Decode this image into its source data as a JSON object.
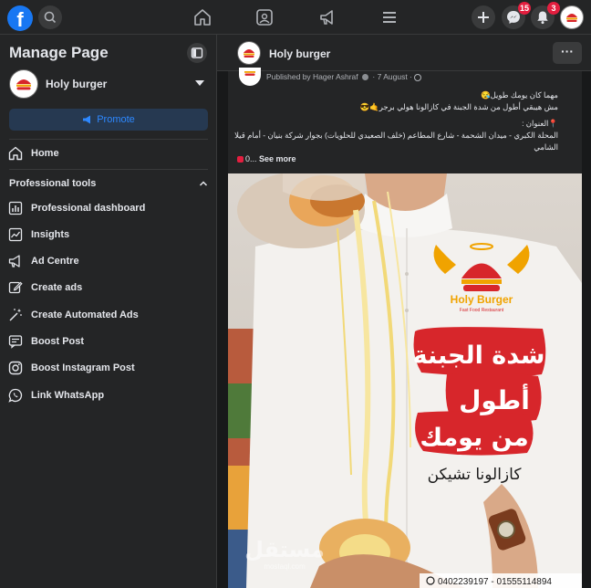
{
  "topbar": {
    "logo": "facebook-logo",
    "logo_text": "f",
    "nav": [
      "home-icon",
      "video-icon",
      "megaphone-icon",
      "menu-icon"
    ],
    "messenger_badge": "15",
    "notifications_badge": "3"
  },
  "sidebar": {
    "title": "Manage Page",
    "page_name": "Holy burger",
    "promote_label": "Promote",
    "home_label": "Home",
    "section_title": "Professional tools",
    "items": [
      {
        "label": "Professional dashboard",
        "icon": "dashboard-icon"
      },
      {
        "label": "Insights",
        "icon": "insights-icon"
      },
      {
        "label": "Ad Centre",
        "icon": "megaphone-icon"
      },
      {
        "label": "Create ads",
        "icon": "pencil-icon"
      },
      {
        "label": "Create Automated Ads",
        "icon": "magic-wand-icon"
      },
      {
        "label": "Boost Post",
        "icon": "boost-post-icon"
      },
      {
        "label": "Boost Instagram Post",
        "icon": "instagram-icon"
      },
      {
        "label": "Link WhatsApp",
        "icon": "whatsapp-icon"
      }
    ]
  },
  "main": {
    "header_name": "Holy burger",
    "more_label": "···",
    "post": {
      "published": "Published by Hager Ashraf",
      "date": "· 7 August ·",
      "lines": [
        "مهما كان يومك طويل😪",
        "مش هيبقي أطول من شدة الجبنة في كازالونا هولي برجر🤙😎",
        "📍العنوان :",
        "المحلة الكبري - ميدان الشحمة - شارع المطاعم (خلف الصعيدي للحلويات) بجوار شركة بنيان - أمام قيلا",
        "الشامي"
      ],
      "see_more_prefix": "0...",
      "see_more": "See more"
    },
    "image": {
      "brand_name": "Holy Burger",
      "brand_tagline": "Fast Food Restaurant",
      "headline_lines": [
        "شدة الجبنة",
        "أطول",
        "من يومك"
      ],
      "subline": "كازالونا تشيكن",
      "phones": "0402239197 - 01555114894",
      "watermark": "مستقل",
      "watermark_sub": "mostaql.com"
    }
  },
  "colors": {
    "accent": "#1877f2",
    "badge": "#e41e3f",
    "promote_text": "#2d88ff",
    "headline_red": "#d7262b"
  }
}
